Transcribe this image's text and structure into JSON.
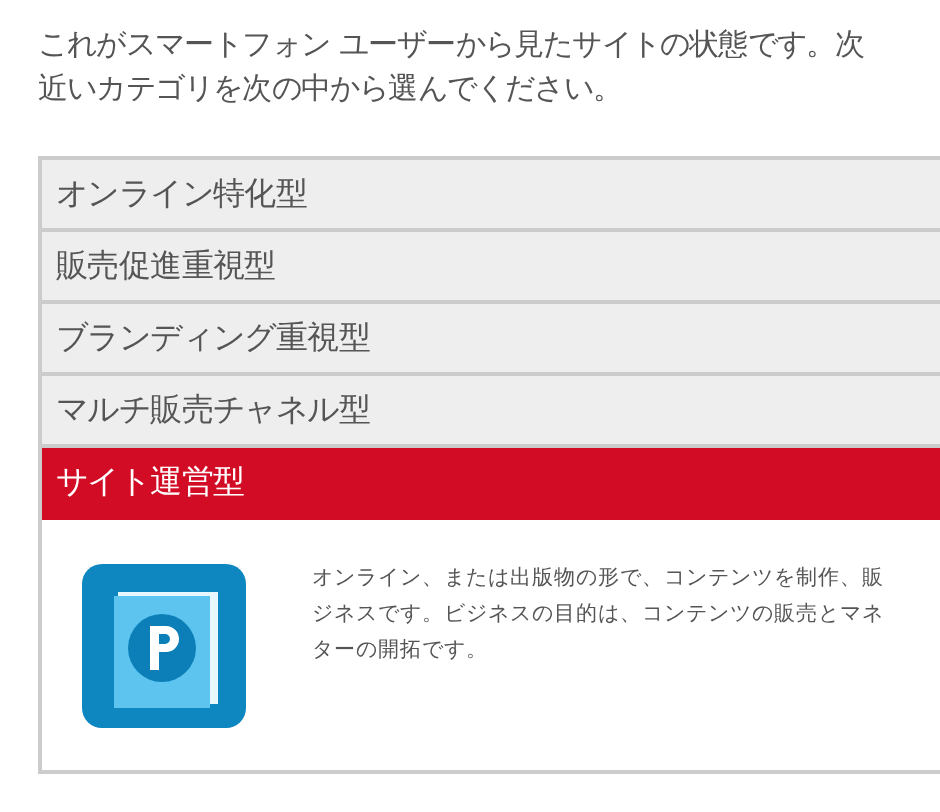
{
  "intro": [
    "これがスマートフォン ユーザーから見たサイトの状態です。次",
    "近いカテゴリを次の中から選んでください。"
  ],
  "categories": [
    {
      "label": "オンライン特化型",
      "selected": false
    },
    {
      "label": "販売促進重視型",
      "selected": false
    },
    {
      "label": "ブランディング重視型",
      "selected": false
    },
    {
      "label": "マルチ販売チャネル型",
      "selected": false
    },
    {
      "label": "サイト運営型",
      "selected": true,
      "description": [
        "オンライン、または出版物の形で、コンテンツを制作、販",
        "ジネスです。ビジネスの目的は、コンテンツの販売とマネ",
        "ターの開拓です。"
      ]
    }
  ]
}
